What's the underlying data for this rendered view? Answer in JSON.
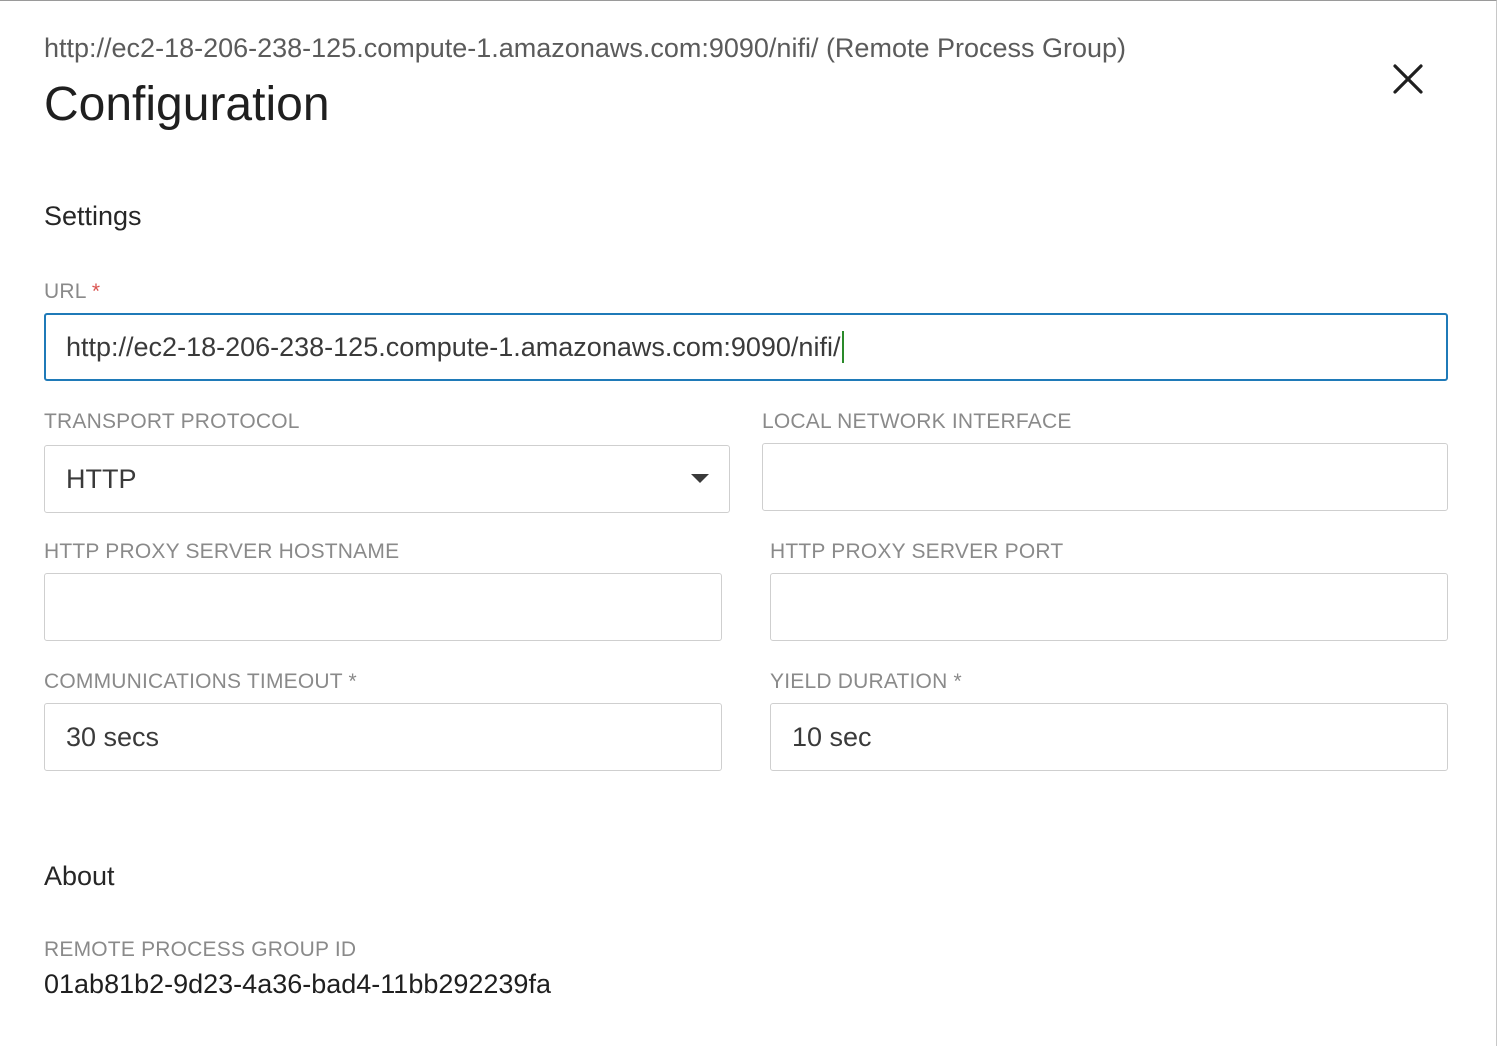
{
  "dialog": {
    "subtitle": "http://ec2-18-206-238-125.compute-1.amazonaws.com:9090/nifi/ (Remote Process Group)",
    "title": "Configuration",
    "close_icon": "close-icon"
  },
  "settings": {
    "heading": "Settings",
    "url": {
      "label": "URL",
      "required_mark": "*",
      "value": "http://ec2-18-206-238-125.compute-1.amazonaws.com:9090/nifi/"
    },
    "transport_protocol": {
      "label": "TRANSPORT PROTOCOL",
      "selected": "HTTP",
      "arrow_icon": "caret-down-icon"
    },
    "local_network_interface": {
      "label": "LOCAL NETWORK INTERFACE",
      "value": ""
    },
    "proxy_hostname": {
      "label": "HTTP PROXY SERVER HOSTNAME",
      "value": ""
    },
    "proxy_port": {
      "label": "HTTP PROXY SERVER PORT",
      "value": ""
    },
    "communications_timeout": {
      "label": "COMMUNICATIONS TIMEOUT",
      "required_mark": "*",
      "value": "30 secs"
    },
    "yield_duration": {
      "label": "YIELD DURATION",
      "required_mark": "*",
      "value": "10 sec"
    }
  },
  "about": {
    "heading": "About",
    "remote_group_id_label": "REMOTE PROCESS GROUP ID",
    "remote_group_id": "01ab81b2-9d23-4a36-bad4-11bb292239fa"
  },
  "colors": {
    "focus_border": "#1f7ab8",
    "required_marker": "#d9534f",
    "label_text": "#8a8a8a"
  }
}
